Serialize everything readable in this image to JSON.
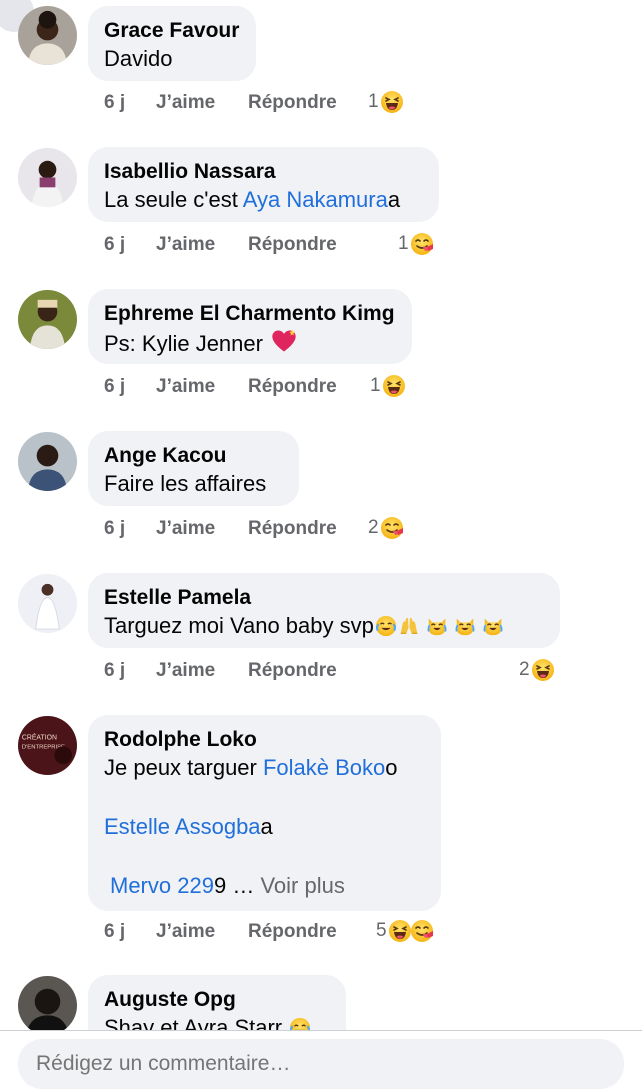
{
  "comments": [
    {
      "author": "Grace Favour",
      "text": "Davido",
      "time": "6 j",
      "like": "J’aime",
      "reply": "Répondre",
      "reactions": "1"
    },
    {
      "author": "Isabellio Nassara",
      "text_before": "La seule c'est ",
      "mention": "Aya Nakamura",
      "text_after": "a",
      "time": "6 j",
      "like": "J’aime",
      "reply": "Répondre",
      "reactions": "1"
    },
    {
      "author": "Ephreme El Charmento Kimg",
      "text": "Ps: Kylie Jenner",
      "time": "6 j",
      "like": "J’aime",
      "reply": "Répondre",
      "reactions": "1"
    },
    {
      "author": "Ange Kacou",
      "text": "Faire les affaires",
      "time": "6 j",
      "like": "J’aime",
      "reply": "Répondre",
      "reactions": "2"
    },
    {
      "author": "Estelle Pamela",
      "text": "Targuez moi Vano baby svp",
      "time": "6 j",
      "like": "J’aime",
      "reply": "Répondre",
      "reactions": "2"
    },
    {
      "author": "Rodolphe Loko",
      "line1_before": "Je peux targuer ",
      "mention1": "Folakè Boko",
      "line1_after": "o",
      "mention2": "Estelle Assogba",
      "line2_after": "a",
      "mention3": "Mervo 229",
      "line3_after": "9",
      "ellipsis": " … ",
      "see_more": "Voir plus",
      "time": "6 j",
      "like": "J’aime",
      "reply": "Répondre",
      "reactions": "5"
    },
    {
      "author": "Auguste Opg",
      "text": "Shay et Ayra Starr"
    }
  ],
  "composer": {
    "placeholder": "Rédigez un commentaire…"
  },
  "avatar_texts": {
    "rodolphe_line1": "CRÉATION",
    "rodolphe_line2": "D'ENTREPRISE"
  },
  "icons": {
    "laugh": "laughing-emoji",
    "yum": "yum-emoji",
    "heart": "sparkling-heart-emoji",
    "pray": "raised-hands-emoji",
    "joycat": "joy-cat-emoji"
  },
  "colors": {
    "bubble": "#f0f2f5",
    "mention": "#216fdb",
    "meta": "#65676b",
    "react_yellow": "#f7b125"
  }
}
